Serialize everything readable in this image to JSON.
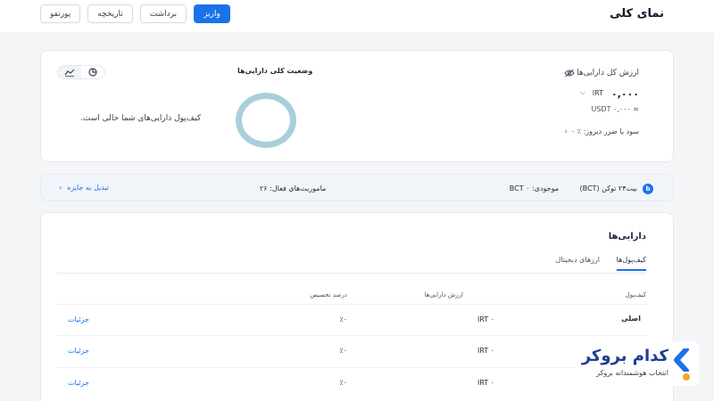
{
  "header": {
    "title": "نمای کلی",
    "tabs": [
      {
        "label": "واریز",
        "active": true
      },
      {
        "label": "برداشت",
        "active": false
      },
      {
        "label": "تاریخچه",
        "active": false
      },
      {
        "label": "پورتفو",
        "active": false
      }
    ]
  },
  "summary": {
    "total_label": "ارزش کل دارایی‌ها",
    "irt_value": "۰,۰۰۰",
    "irt_unit": "IRT",
    "usdt_value": "≈ ۰,۰۰۰ USDT",
    "pnl": "سود یا ضرر دیروز: ٪ ۰",
    "status_title": "وضعیت کلی دارایی‌ها",
    "empty_message": "کیف‌پول دارایی‌های شما خالی است."
  },
  "bct": {
    "logo": "b",
    "name": "بیت۲۴ توکن (BCT)",
    "balance": "موجودی: ۰ BCT",
    "missions": "ماموریت‌های فعال: ۲۶",
    "convert_label": "تبدیل به جایزه"
  },
  "assets": {
    "title": "دارایی‌ها",
    "tabs": [
      {
        "label": "کیف‌پول‌ها",
        "active": true
      },
      {
        "label": "ارزهای دیجیتال",
        "active": false
      }
    ],
    "columns": [
      "کیف‌پول",
      "ارزش دارایی‌ها",
      "درصد تخصیص"
    ],
    "rows": [
      {
        "wallet": "اصلی",
        "value": "IRT ۰",
        "percent": "٪۰",
        "action": "جزئیات"
      },
      {
        "wallet": "",
        "value": "IRT ۰",
        "percent": "٪۰",
        "action": "جزئیات"
      },
      {
        "wallet": "",
        "value": "IRT ۰",
        "percent": "٪۰",
        "action": "جزئیات"
      }
    ]
  },
  "brand": {
    "name": "کدام بروکر",
    "tagline": "انتخاب هوشمندانه بروکر",
    "colors": {
      "primary": "#1a73e8",
      "accent": "#f5a623"
    }
  }
}
